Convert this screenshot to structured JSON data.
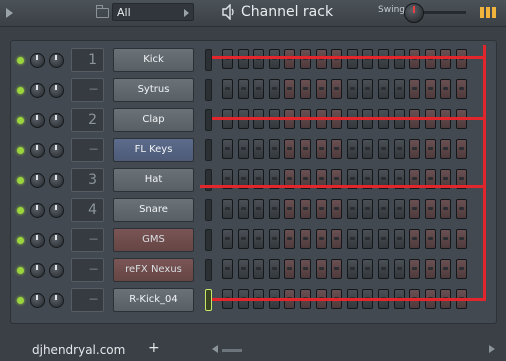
{
  "header": {
    "filter_value": "All",
    "title": "Channel rack",
    "swing_label": "Swing"
  },
  "channels": [
    {
      "route": "1",
      "name": "Kick",
      "style": "normal"
    },
    {
      "route": "---",
      "name": "Sytrus",
      "style": "normal"
    },
    {
      "route": "2",
      "name": "Clap",
      "style": "normal"
    },
    {
      "route": "---",
      "name": "FL Keys",
      "style": "blue"
    },
    {
      "route": "3",
      "name": "Hat",
      "style": "normal"
    },
    {
      "route": "4",
      "name": "Snare",
      "style": "normal"
    },
    {
      "route": "---",
      "name": "GMS",
      "style": "red"
    },
    {
      "route": "---",
      "name": "reFX Nexus",
      "style": "red"
    },
    {
      "route": "---",
      "name": "R-Kick_04",
      "style": "normal"
    }
  ],
  "steps_per_channel": 16,
  "highlighted_step_groups": [
    5,
    6,
    7,
    8,
    13,
    14,
    15,
    16
  ],
  "footer": {
    "watermark": "djhendryal.com",
    "add_label": "+"
  },
  "colors": {
    "led": "#9bd43d",
    "annotation": "#e2262c",
    "selected_channel_border": "#c8e86a"
  }
}
